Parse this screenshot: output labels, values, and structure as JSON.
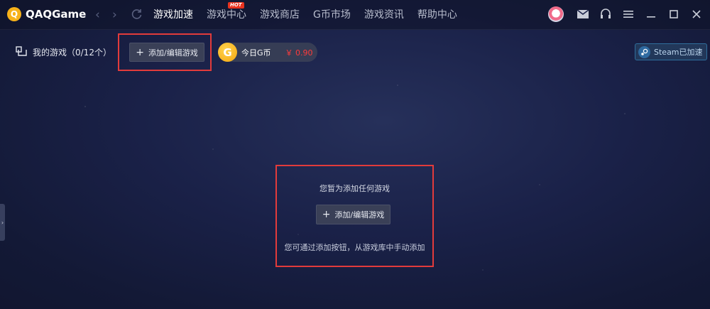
{
  "app": {
    "name": "QAQGame",
    "logo_glyph": "Q"
  },
  "nav": {
    "tabs": [
      {
        "label": "游戏加速",
        "active": true
      },
      {
        "label": "游戏中心",
        "badge": "HOT"
      },
      {
        "label": "游戏商店"
      },
      {
        "label": "G币市场"
      },
      {
        "label": "游戏资讯"
      },
      {
        "label": "帮助中心"
      }
    ]
  },
  "toolbar": {
    "my_games_label": "我的游戏（0/12个）",
    "add_edit_label": "添加/编辑游戏",
    "gcoin": {
      "icon_glyph": "G",
      "label": "今日G币",
      "value": "￥ 0.90"
    },
    "steam_label": "Steam已加速"
  },
  "empty_state": {
    "title": "您暂为添加任何游戏",
    "button_label": "添加/编辑游戏",
    "hint": "您可通过添加按钮，从游戏库中手动添加"
  },
  "colors": {
    "accent_red": "#e23b3b",
    "gcoin_gold": "#f5a70f",
    "price_red": "#ff3b3b"
  }
}
